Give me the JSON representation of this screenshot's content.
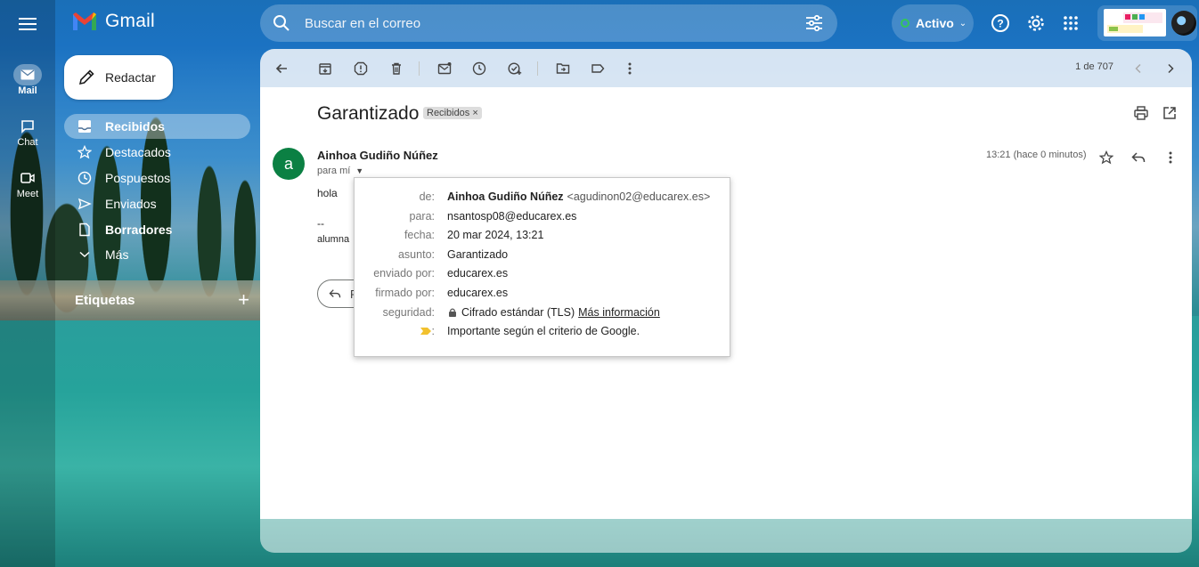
{
  "app": {
    "name": "Gmail",
    "search_placeholder": "Buscar en el correo",
    "status_label": "Activo"
  },
  "rail": [
    {
      "label": "Mail",
      "icon": "mail-icon",
      "active": true
    },
    {
      "label": "Chat",
      "icon": "chat-icon",
      "active": false
    },
    {
      "label": "Meet",
      "icon": "video-icon",
      "active": false
    }
  ],
  "sidebar": {
    "compose_label": "Redactar",
    "items": [
      {
        "label": "Recibidos",
        "icon": "inbox-icon"
      },
      {
        "label": "Destacados",
        "icon": "star-icon"
      },
      {
        "label": "Pospuestos",
        "icon": "clock-icon"
      },
      {
        "label": "Enviados",
        "icon": "send-icon"
      },
      {
        "label": "Borradores",
        "icon": "draft-icon"
      },
      {
        "label": "Más",
        "icon": "chevron-down-icon"
      }
    ],
    "labels_title": "Etiquetas",
    "labels_add": "+"
  },
  "toolbar": {
    "pager": "1 de 707"
  },
  "message": {
    "subject": "Garantizado",
    "label_chip": "Recibidos ×",
    "sender_initial": "a",
    "sender_name": "Ainhoa Gudiño Núñez",
    "recipient_summary": "para mí",
    "timestamp": "13:21 (hace 0 minutos)",
    "body": "hola",
    "signature_dash": "--",
    "signature": "alumna",
    "reply_label": "R"
  },
  "details": {
    "from_label": "de:",
    "from_name": "Ainhoa Gudiño Núñez",
    "from_email": "<agudinon02@educarex.es>",
    "to_label": "para:",
    "to_value": "nsantosp08@educarex.es",
    "date_label": "fecha:",
    "date_value": "20 mar 2024, 13:21",
    "subject_label": "asunto:",
    "subject_value": "Garantizado",
    "mailed_by_label": "enviado por:",
    "mailed_by_value": "educarex.es",
    "signed_by_label": "firmado por:",
    "signed_by_value": "educarex.es",
    "security_label": "seguridad:",
    "security_value": "Cifrado estándar (TLS)",
    "security_link": "Más información",
    "importance_colon": ":",
    "importance_value": "Importante según el criterio de Google."
  },
  "colors": {
    "accent_avatar": "#0b8043",
    "importance_marker": "#f2c12e",
    "status_dot": "#34c759"
  }
}
